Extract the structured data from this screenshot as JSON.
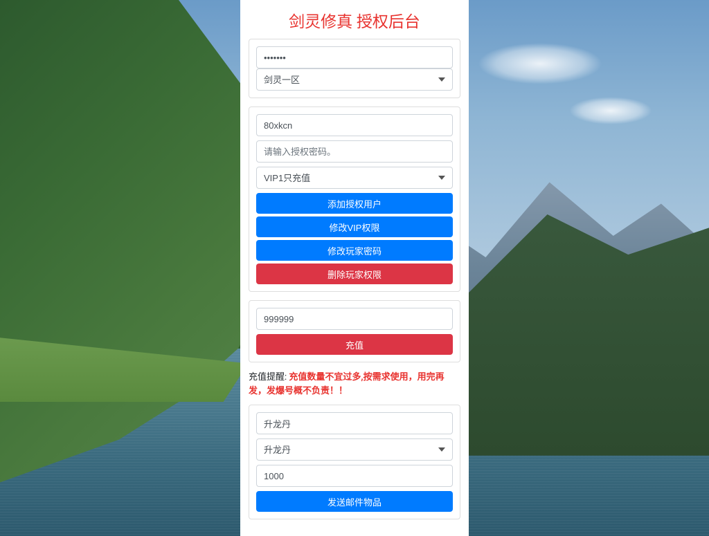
{
  "title": "剑灵修真 授权后台",
  "section1": {
    "password_value": "•••••••",
    "server_selected": "剑灵一区"
  },
  "section2": {
    "username_value": "80xkcn",
    "auth_password_placeholder": "请输入授权密码。",
    "vip_selected": "VIP1只充值",
    "btn_add_user": "添加授权用户",
    "btn_modify_vip": "修改VIP权限",
    "btn_modify_password": "修改玩家密码",
    "btn_delete_perm": "删除玩家权限"
  },
  "section3": {
    "amount_value": "999999",
    "btn_recharge": "充值"
  },
  "notice": {
    "label": "充值提醒: ",
    "text": "充值数量不宜过多,按需求使用，用完再发，发爆号概不负责！！"
  },
  "section4": {
    "item_input_value": "升龙丹",
    "item_select_value": "升龙丹",
    "quantity_value": "1000",
    "btn_send_mail": "发送邮件物品"
  }
}
